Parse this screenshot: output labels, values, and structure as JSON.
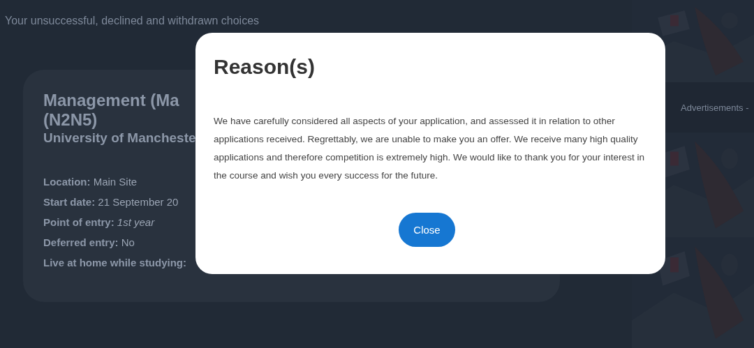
{
  "page": {
    "heading": "Your unsuccessful, declined and withdrawn choices"
  },
  "choice_card": {
    "course": "Management (Ma",
    "course_code": "(N2N5)",
    "university": "University of Mancheste",
    "details": [
      {
        "label": "Location:",
        "value": "Main Site",
        "italic": false
      },
      {
        "label": "Start date:",
        "value": "21 September 20",
        "italic": false
      },
      {
        "label": "Point of entry:",
        "value": "1st year",
        "italic": true
      },
      {
        "label": "Deferred entry:",
        "value": "No",
        "italic": false
      },
      {
        "label": "Live at home while studying:"
      }
    ]
  },
  "sidebar": {
    "ad_label": "Advertisements -"
  },
  "dialog": {
    "title": "Reason(s)",
    "message": "We have carefully considered all aspects of your application, and assessed it in relation to other applications received. Regrettably, we are unable to make you an offer. We receive many high quality applications and therefore competition is extremely high. We would like to thank you for your interest in the course and wish you every success for the future.",
    "close_button": "Close"
  }
}
